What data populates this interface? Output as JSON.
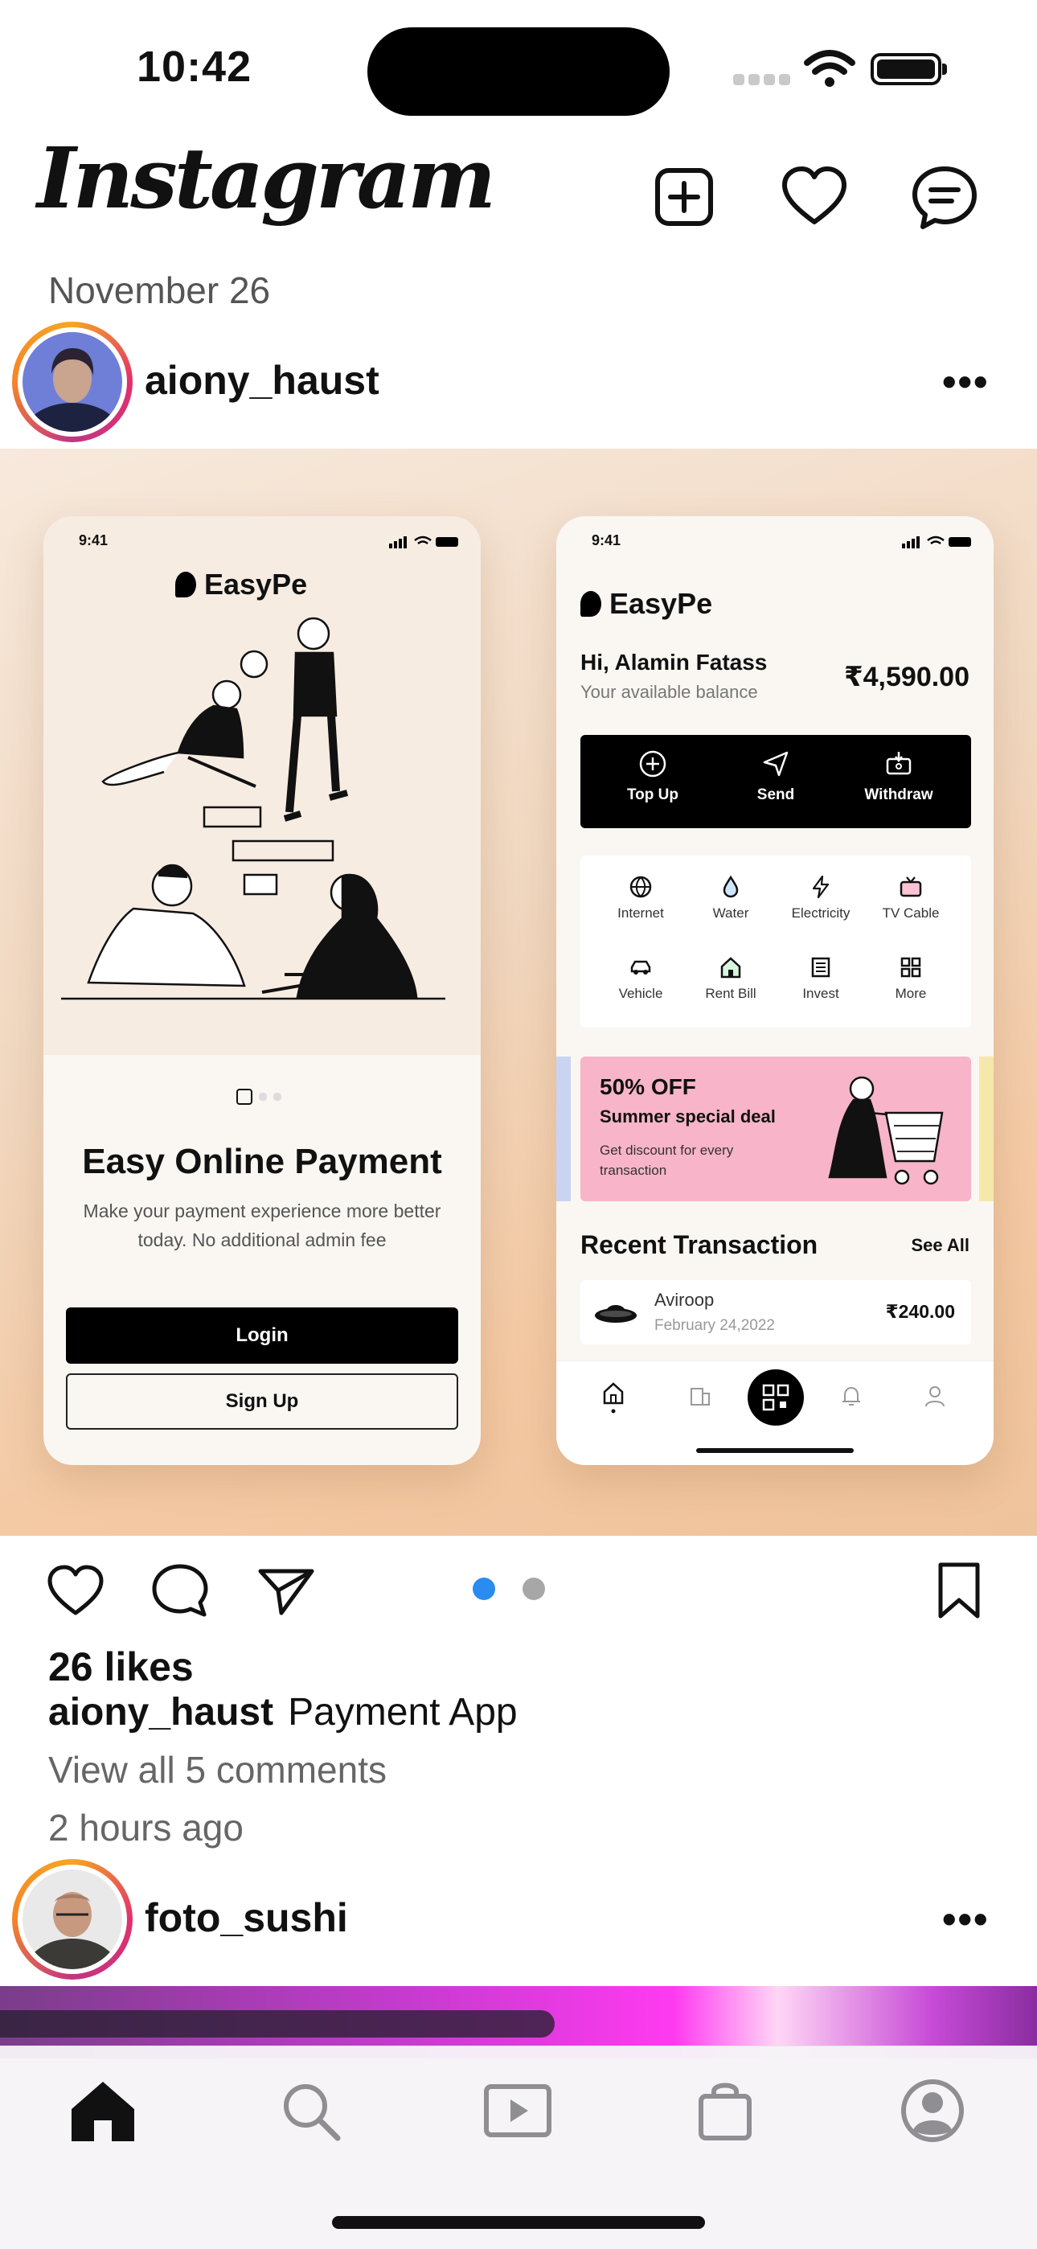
{
  "status_bar": {
    "time": "10:42"
  },
  "header": {
    "logo": "Instagram"
  },
  "post": {
    "date": "November 26",
    "username": "aiony_haust",
    "more_label": "•••",
    "likes": "26 likes",
    "caption_user": "aiony_haust",
    "caption_text": "Payment App",
    "comments_link": "View all 5 comments",
    "time_ago": "2 hours ago",
    "carousel": {
      "current": 1,
      "total": 2
    },
    "media": {
      "left_phone": {
        "status_time": "9:41",
        "brand": "EasyPe",
        "title": "Easy Online Payment",
        "subtitle": "Make your payment experience more better today. No additional admin fee",
        "login": "Login",
        "signup": "Sign Up"
      },
      "right_phone": {
        "status_time": "9:41",
        "brand": "EasyPe",
        "greeting": "Hi, Alamin Fatass",
        "balance_label": "Your available balance",
        "balance": "₹4,590.00",
        "actions": [
          "Top Up",
          "Send",
          "Withdraw"
        ],
        "services": [
          "Internet",
          "Water",
          "Electricity",
          "TV Cable",
          "Vehicle",
          "Rent Bill",
          "Invest",
          "More"
        ],
        "promo_title": "50% OFF",
        "promo_sub": "Summer special deal",
        "promo_desc": "Get discount for every transaction",
        "recent_title": "Recent Transaction",
        "see_all": "See All",
        "tx_name": "Aviroop",
        "tx_date": "February 24,2022",
        "tx_amount": "₹240.00"
      }
    }
  },
  "next_post": {
    "username": "foto_sushi",
    "more_label": "•••"
  },
  "colors": {
    "accent_blue": "#2a8cf0",
    "text": "#111111",
    "secondary": "#666666"
  },
  "tabs": [
    "home-icon",
    "search-icon",
    "reels-icon",
    "shop-icon",
    "profile-icon"
  ]
}
